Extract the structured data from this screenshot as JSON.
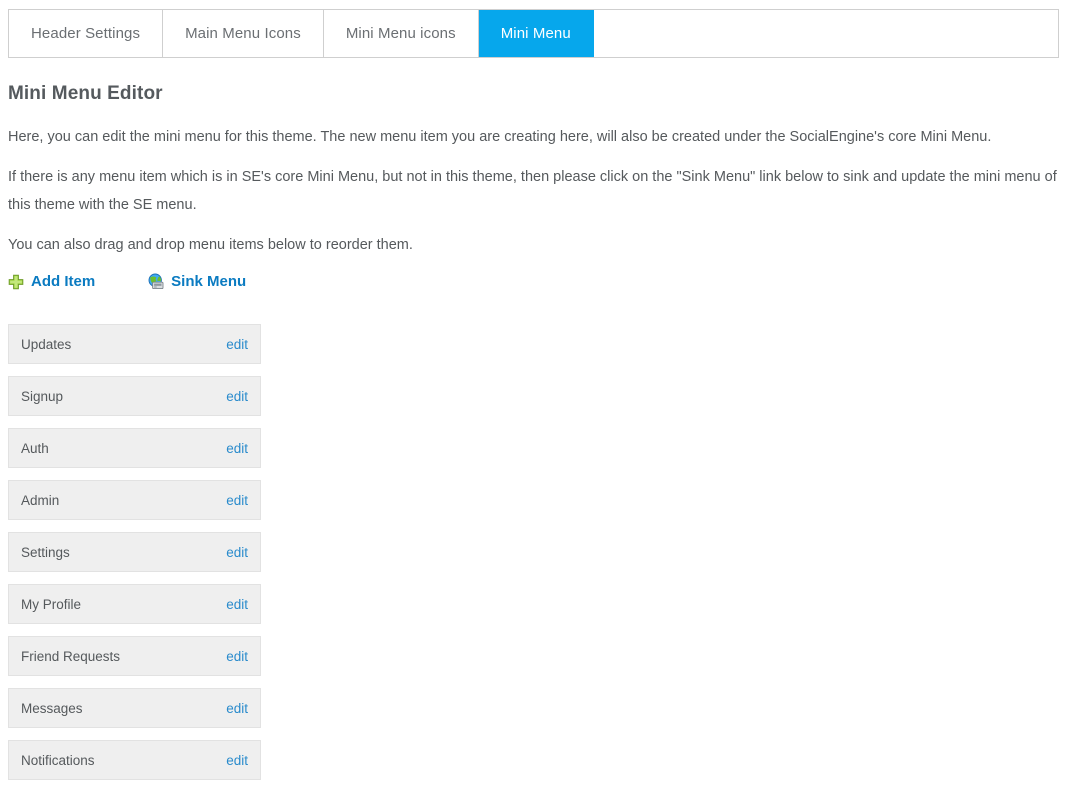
{
  "tabs": [
    {
      "label": "Header Settings",
      "active": false,
      "name": "tab-header-settings"
    },
    {
      "label": "Main Menu Icons",
      "active": false,
      "name": "tab-main-menu-icons"
    },
    {
      "label": "Mini Menu icons",
      "active": false,
      "name": "tab-mini-menu-icons"
    },
    {
      "label": "Mini Menu",
      "active": true,
      "name": "tab-mini-menu"
    }
  ],
  "page": {
    "title": "Mini Menu Editor",
    "paragraphs": [
      "Here, you can edit the mini menu for this theme. The new menu item you are creating here, will also be created under the SocialEngine's core Mini Menu.",
      "If there is any menu item which is in SE's core Mini Menu, but not in this theme, then please click on the \"Sink Menu\" link below to sink and update the mini menu of this theme with the SE menu.",
      "You can also drag and drop menu items below to reorder them."
    ]
  },
  "actions": [
    {
      "label": "Add Item",
      "icon": "plus-green-icon",
      "name": "add-item-link"
    },
    {
      "label": "Sink Menu",
      "icon": "globe-sync-icon",
      "name": "sink-menu-link"
    }
  ],
  "menu_items": [
    {
      "label": "Updates",
      "edit_label": "edit"
    },
    {
      "label": "Signup",
      "edit_label": "edit"
    },
    {
      "label": "Auth",
      "edit_label": "edit"
    },
    {
      "label": "Admin",
      "edit_label": "edit"
    },
    {
      "label": "Settings",
      "edit_label": "edit"
    },
    {
      "label": "My Profile",
      "edit_label": "edit"
    },
    {
      "label": "Friend Requests",
      "edit_label": "edit"
    },
    {
      "label": "Messages",
      "edit_label": "edit"
    },
    {
      "label": "Notifications",
      "edit_label": "edit"
    }
  ],
  "colors": {
    "active_tab_bg": "#06a7ec",
    "link_blue": "#0b7bc1",
    "edit_link_blue": "#2a8bcc",
    "row_bg": "#efefef",
    "row_border": "#e2e2e2",
    "text": "#55595c",
    "tab_border": "#cfcfcf",
    "plus_green": "#8cc63f"
  }
}
